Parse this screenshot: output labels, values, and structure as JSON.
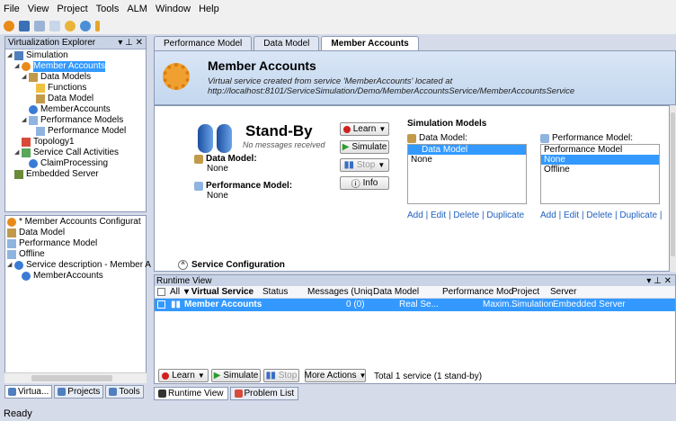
{
  "menu": [
    "File",
    "View",
    "Project",
    "Tools",
    "ALM",
    "Window",
    "Help"
  ],
  "explorer": {
    "title": "Virtualization Explorer",
    "pin": "▾ ⊥ ✕",
    "items": [
      "Simulation",
      "Member Accounts",
      "Data Models",
      "Functions",
      "Data Model",
      "MemberAccounts",
      "Performance Models",
      "Performance Model",
      "Topology1",
      "Service Call Activities",
      "ClaimProcessing",
      "Embedded Server"
    ]
  },
  "config_tree": [
    "* Member Accounts Configurat",
    "Data Model",
    "Performance Model",
    "Offline",
    "Service description - Member A",
    "MemberAccounts"
  ],
  "left_tabs": [
    "Virtua...",
    "Projects",
    "Tools"
  ],
  "doc_tabs": [
    "Performance Model",
    "Data Model",
    "Member Accounts"
  ],
  "service": {
    "title": "Member Accounts",
    "desc": "Virtual service created from service 'MemberAccounts' located at http://localhost:8101/ServiceSimulation/Demo/MemberAccountsService/MemberAccountsService",
    "mode": "Stand-By",
    "mode_sub": "No messages received",
    "dm_label": "Data Model:",
    "dm_val": "None",
    "pm_label": "Performance Model:",
    "pm_val": "None",
    "learn": "Learn",
    "simulate": "Simulate",
    "stop": "Stop",
    "info": "Info",
    "config": "Service Configuration"
  },
  "sim_models": {
    "title": "Simulation Models",
    "dm_label": "Data Model:",
    "dm_items": [
      "Data Model",
      "None"
    ],
    "pm_label": "Performance Model:",
    "pm_items": [
      "Performance Model",
      "None",
      "Offline"
    ],
    "links1": "Add | Edit | Delete | Duplicate",
    "links2": "Add | Edit | Delete | Duplicate |"
  },
  "runtime": {
    "title": "Runtime View",
    "pin": "▾ ⊥ ✕",
    "cols": {
      "all": "All",
      "vs": "▾ Virtual Service",
      "status": "Status",
      "msgs": "Messages (Uniq",
      "dm": "Data Model",
      "pm": "Performance Mod",
      "project": "Project",
      "server": "Server"
    },
    "row": {
      "name": "Member Accounts",
      "msgs": "0 (0)",
      "dm": "Real Se...",
      "pm": "Maxim...",
      "project": "Simulation",
      "server": "Embedded Server"
    },
    "learn": "Learn",
    "simulate": "Simulate",
    "stop": "Stop",
    "more": "More Actions",
    "total": "Total 1 service (1 stand-by)"
  },
  "bottom_tabs": [
    "Runtime View",
    "Problem List"
  ],
  "status": "Ready"
}
